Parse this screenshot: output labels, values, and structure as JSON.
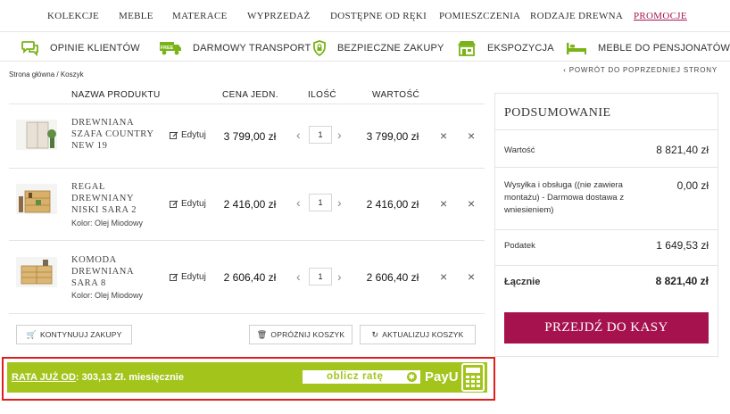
{
  "nav": {
    "items": [
      "KOLEKCJE",
      "MEBLE",
      "MATERACE",
      "WYPRZEDAŻ",
      "DOSTĘPNE OD RĘKI",
      "POMIESZCZENIA",
      "RODZAJE DREWNA",
      "PROMOCJE"
    ]
  },
  "features": {
    "items": [
      "OPINIE KLIENTÓW",
      "DARMOWY TRANSPORT",
      "BEZPIECZNE ZAKUPY",
      "EKSPOZYCJA",
      "MEBLE DO PENSJONATÓW"
    ],
    "truck_badge": "FREE"
  },
  "breadcrumb": "Strona główna / Koszyk",
  "back_link": "‹ POWRÓT DO POPRZEDNIEJ STRONY",
  "table": {
    "headers": {
      "name": "NAZWA PRODUKTU",
      "unit_price": "CENA JEDN.",
      "qty": "ILOŚĆ",
      "value": "WARTOŚĆ"
    },
    "edit_label": "Edytuj",
    "rows": [
      {
        "name": "DREWNIANA SZAFA COUNTRY NEW 19",
        "variant": "",
        "unit_price": "3 799,00 zł",
        "qty": "1",
        "value": "3 799,00 zł"
      },
      {
        "name": "REGAŁ DREWNIANY NISKI SARA 2",
        "variant": "Kolor:  Olej Miodowy",
        "unit_price": "2 416,00 zł",
        "qty": "1",
        "value": "2 416,00 zł"
      },
      {
        "name": "KOMODA DREWNIANA SARA 8",
        "variant": "Kolor:  Olej Miodowy",
        "unit_price": "2 606,40 zł",
        "qty": "1",
        "value": "2 606,40 zł"
      }
    ]
  },
  "buttons": {
    "continue": "KONTYNUUJ ZAKUPY",
    "empty": "OPRÓŻNIJ KOSZYK",
    "update": "AKTUALIZUJ KOSZYK"
  },
  "summary": {
    "title": "PODSUMOWANIE",
    "lines": [
      {
        "label": "Wartość",
        "value": "8 821,40 zł"
      },
      {
        "label": "Wysyłka i obsługa ((nie zawiera montażu) - Darmowa dostawa z wniesieniem)",
        "value": "0,00 zł"
      },
      {
        "label": "Podatek",
        "value": "1 649,53 zł"
      },
      {
        "label": "Łącznie",
        "value": "8 821,40 zł"
      }
    ],
    "checkout": "PRZEJDŹ DO KASY"
  },
  "payu": {
    "rata_label": "RATA JUŻ OD",
    "rata_value": ": 303,13 Zł. miesięcznie",
    "calc_button": "oblicz ratę",
    "logo": "PayU"
  },
  "colors": {
    "accent": "#a5124d",
    "payu_green": "#a3c41b",
    "highlight_border": "#e01e1e"
  }
}
